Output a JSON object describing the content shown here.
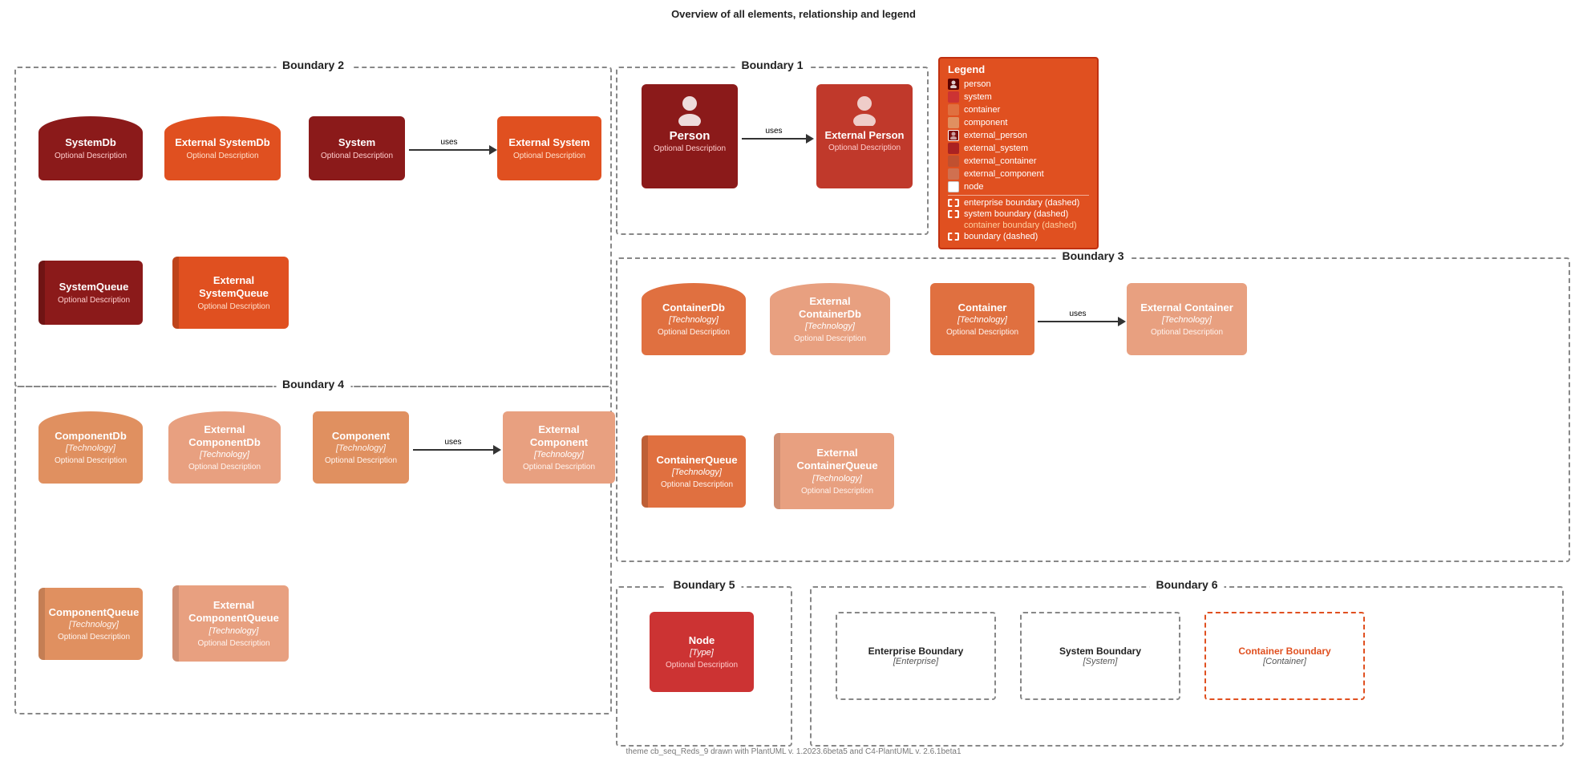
{
  "page": {
    "title": "Overview of all elements, relationship and legend",
    "footer": "theme cb_seq_Reds_9 drawn with PlantUML v. 1.2023.6beta5 and C4-PlantUML v. 2.6.1beta1"
  },
  "boundary2": {
    "title": "Boundary 2",
    "systemDb": {
      "name": "SystemDb",
      "desc": "Optional Description"
    },
    "extSystemDb": {
      "name": "External SystemDb",
      "desc": "Optional Description"
    },
    "system": {
      "name": "System",
      "desc": "Optional Description"
    },
    "extSystem": {
      "name": "External System",
      "desc": "Optional Description"
    },
    "arrow1": "uses",
    "systemQueue": {
      "name": "SystemQueue",
      "desc": "Optional Description"
    },
    "extSystemQueue": {
      "name": "External SystemQueue",
      "desc": "Optional Description"
    }
  },
  "boundary1": {
    "title": "Boundary 1",
    "person": {
      "name": "Person",
      "desc": "Optional Description"
    },
    "extPerson": {
      "name": "External Person",
      "desc": "Optional Description"
    },
    "arrow1": "uses"
  },
  "boundary3": {
    "title": "Boundary 3",
    "containerDb": {
      "name": "ContainerDb",
      "tech": "[Technology]",
      "desc": "Optional Description"
    },
    "extContainerDb": {
      "name": "External ContainerDb",
      "tech": "[Technology]",
      "desc": "Optional Description"
    },
    "container": {
      "name": "Container",
      "tech": "[Technology]",
      "desc": "Optional Description"
    },
    "extContainer": {
      "name": "External Container",
      "tech": "[Technology]",
      "desc": "Optional Description"
    },
    "arrow1": "uses",
    "containerQueue": {
      "name": "ContainerQueue",
      "tech": "[Technology]",
      "desc": "Optional Description"
    },
    "extContainerQueue": {
      "name": "External ContainerQueue",
      "tech": "[Technology]",
      "desc": "Optional Description"
    }
  },
  "boundary4": {
    "title": "Boundary 4",
    "componentDb": {
      "name": "ComponentDb",
      "tech": "[Technology]",
      "desc": "Optional Description"
    },
    "extComponentDb": {
      "name": "External ComponentDb",
      "tech": "[Technology]",
      "desc": "Optional Description"
    },
    "component": {
      "name": "Component",
      "tech": "[Technology]",
      "desc": "Optional Description"
    },
    "extComponent": {
      "name": "External Component",
      "tech": "[Technology]",
      "desc": "Optional Description"
    },
    "arrow1": "uses",
    "componentQueue": {
      "name": "ComponentQueue",
      "tech": "[Technology]",
      "desc": "Optional Description"
    },
    "extComponentQueue": {
      "name": "External ComponentQueue",
      "tech": "[Technology]",
      "desc": "Optional Description"
    }
  },
  "boundary5": {
    "title": "Boundary 5",
    "node": {
      "name": "Node",
      "tech": "[Type]",
      "desc": "Optional Description"
    }
  },
  "boundary6": {
    "title": "Boundary 6",
    "enterprise": {
      "name": "Enterprise Boundary",
      "sub": "[Enterprise]"
    },
    "system": {
      "name": "System Boundary",
      "sub": "[System]"
    },
    "container": {
      "name": "Container Boundary",
      "sub": "[Container]"
    }
  },
  "legend": {
    "title": "Legend",
    "items": [
      {
        "label": "person",
        "color": "#5B0000"
      },
      {
        "label": "system",
        "color": "#CC3333"
      },
      {
        "label": "container",
        "color": "#E07040"
      },
      {
        "label": "component",
        "color": "#E09060"
      },
      {
        "label": "external_person",
        "color": "#7B1111"
      },
      {
        "label": "external_system",
        "color": "#AA2222"
      },
      {
        "label": "external_container",
        "color": "#C05030"
      },
      {
        "label": "external_component",
        "color": "#D07050"
      },
      {
        "label": "node",
        "color": "#ffffff"
      }
    ],
    "boundaries": [
      {
        "label": "enterprise boundary (dashed)",
        "color": "#888"
      },
      {
        "label": "system boundary (dashed)",
        "color": "#888"
      },
      {
        "label": "container boundary (dashed)",
        "color": "#E05020"
      },
      {
        "label": "boundary (dashed)",
        "color": "#888"
      }
    ]
  }
}
